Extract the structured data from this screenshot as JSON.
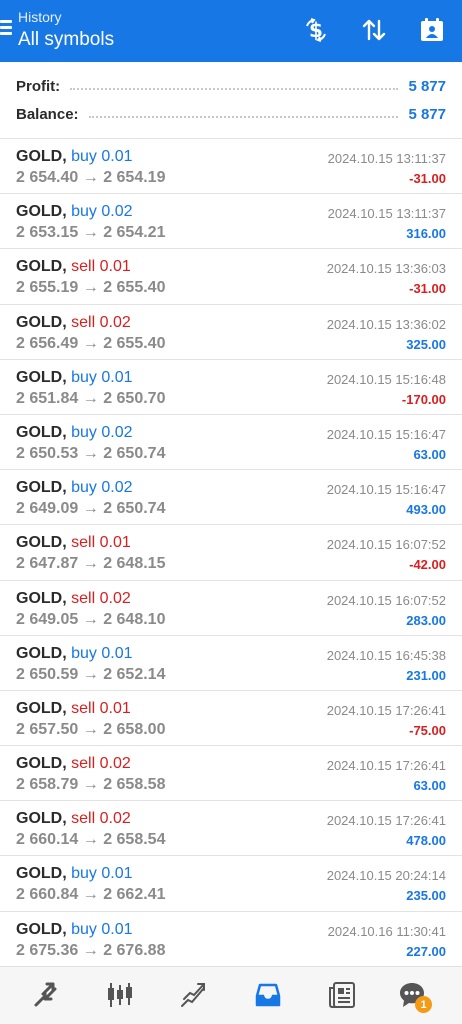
{
  "header": {
    "subtitle": "History",
    "title": "All symbols"
  },
  "summary": {
    "profit_label": "Profit:",
    "profit_value": "5 877",
    "balance_label": "Balance:",
    "balance_value": "5 877"
  },
  "deals": [
    {
      "symbol": "GOLD,",
      "side": "buy",
      "volume": "0.01",
      "open": "2 654.40",
      "close": "2 654.19",
      "time": "2024.10.15 13:11:37",
      "profit": "-31.00"
    },
    {
      "symbol": "GOLD,",
      "side": "buy",
      "volume": "0.02",
      "open": "2 653.15",
      "close": "2 654.21",
      "time": "2024.10.15 13:11:37",
      "profit": "316.00"
    },
    {
      "symbol": "GOLD,",
      "side": "sell",
      "volume": "0.01",
      "open": "2 655.19",
      "close": "2 655.40",
      "time": "2024.10.15 13:36:03",
      "profit": "-31.00"
    },
    {
      "symbol": "GOLD,",
      "side": "sell",
      "volume": "0.02",
      "open": "2 656.49",
      "close": "2 655.40",
      "time": "2024.10.15 13:36:02",
      "profit": "325.00"
    },
    {
      "symbol": "GOLD,",
      "side": "buy",
      "volume": "0.01",
      "open": "2 651.84",
      "close": "2 650.70",
      "time": "2024.10.15 15:16:48",
      "profit": "-170.00"
    },
    {
      "symbol": "GOLD,",
      "side": "buy",
      "volume": "0.02",
      "open": "2 650.53",
      "close": "2 650.74",
      "time": "2024.10.15 15:16:47",
      "profit": "63.00"
    },
    {
      "symbol": "GOLD,",
      "side": "buy",
      "volume": "0.02",
      "open": "2 649.09",
      "close": "2 650.74",
      "time": "2024.10.15 15:16:47",
      "profit": "493.00"
    },
    {
      "symbol": "GOLD,",
      "side": "sell",
      "volume": "0.01",
      "open": "2 647.87",
      "close": "2 648.15",
      "time": "2024.10.15 16:07:52",
      "profit": "-42.00"
    },
    {
      "symbol": "GOLD,",
      "side": "sell",
      "volume": "0.02",
      "open": "2 649.05",
      "close": "2 648.10",
      "time": "2024.10.15 16:07:52",
      "profit": "283.00"
    },
    {
      "symbol": "GOLD,",
      "side": "buy",
      "volume": "0.01",
      "open": "2 650.59",
      "close": "2 652.14",
      "time": "2024.10.15 16:45:38",
      "profit": "231.00"
    },
    {
      "symbol": "GOLD,",
      "side": "sell",
      "volume": "0.01",
      "open": "2 657.50",
      "close": "2 658.00",
      "time": "2024.10.15 17:26:41",
      "profit": "-75.00"
    },
    {
      "symbol": "GOLD,",
      "side": "sell",
      "volume": "0.02",
      "open": "2 658.79",
      "close": "2 658.58",
      "time": "2024.10.15 17:26:41",
      "profit": "63.00"
    },
    {
      "symbol": "GOLD,",
      "side": "sell",
      "volume": "0.02",
      "open": "2 660.14",
      "close": "2 658.54",
      "time": "2024.10.15 17:26:41",
      "profit": "478.00"
    },
    {
      "symbol": "GOLD,",
      "side": "buy",
      "volume": "0.01",
      "open": "2 660.84",
      "close": "2 662.41",
      "time": "2024.10.15 20:24:14",
      "profit": "235.00"
    },
    {
      "symbol": "GOLD,",
      "side": "buy",
      "volume": "0.01",
      "open": "2 675.36",
      "close": "2 676.88",
      "time": "2024.10.16 11:30:41",
      "profit": "227.00"
    }
  ],
  "arrow_glyph": "→",
  "bottom_nav": {
    "items": [
      "quotes-icon",
      "chart-icon",
      "trade-icon",
      "history-icon",
      "news-icon",
      "messages-icon"
    ],
    "active": "history-icon",
    "messages_badge": "1"
  },
  "colors": {
    "accent": "#1777e5",
    "sell": "#d81e1e",
    "badge": "#f59a14"
  }
}
